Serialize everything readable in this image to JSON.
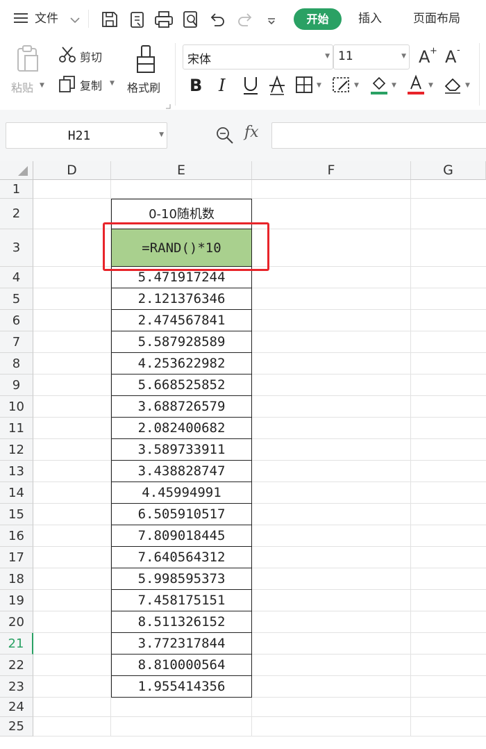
{
  "menubar": {
    "file_label": "文件",
    "tabs": [
      "开始",
      "插入",
      "页面布局"
    ]
  },
  "ribbon": {
    "paste_label": "粘贴",
    "cut_label": "剪切",
    "copy_label": "复制",
    "format_painter_label": "格式刷",
    "font_name": "宋体",
    "font_size": "11"
  },
  "formula_bar": {
    "name_box": "H21",
    "fx_label": "fx",
    "formula": ""
  },
  "sheet": {
    "columns": [
      "D",
      "E",
      "F",
      "G"
    ],
    "rows": [
      "1",
      "2",
      "3",
      "4",
      "5",
      "6",
      "7",
      "8",
      "9",
      "10",
      "11",
      "12",
      "13",
      "14",
      "15",
      "16",
      "17",
      "18",
      "19",
      "20",
      "21",
      "22",
      "23",
      "24",
      "25"
    ],
    "active_row": "21",
    "header_cell": "0-10随机数",
    "formula_cell": "=RAND()*10",
    "values": [
      "5.471917244",
      "2.121376346",
      "2.474567841",
      "5.587928589",
      "4.253622982",
      "5.668525852",
      "3.688726579",
      "2.082400682",
      "3.589733911",
      "3.438828747",
      "4.45994991",
      "6.505910517",
      "7.809018445",
      "7.640564312",
      "5.998595373",
      "7.458175151",
      "8.511326152",
      "3.772317844",
      "8.810000564",
      "1.955414356"
    ]
  },
  "colors": {
    "accent": "#2aa164",
    "formula_cell_fill": "#a9d08e",
    "highlight_box": "#e8242a"
  }
}
